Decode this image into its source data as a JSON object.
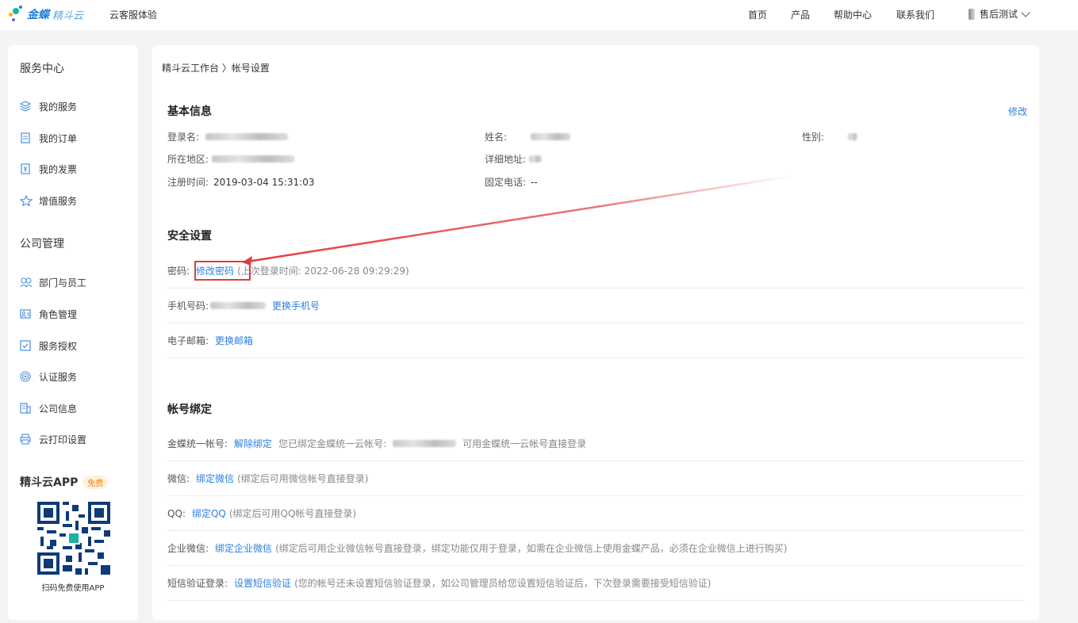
{
  "header": {
    "logo_text": "金蝶",
    "logo_sub": "精斗云",
    "app_name": "云客服体验",
    "nav": [
      "首页",
      "产品",
      "帮助中心",
      "联系我们"
    ],
    "user_name": "售后测试"
  },
  "sidebar": {
    "service_center": "服务中心",
    "service_items": [
      "我的服务",
      "我的订单",
      "我的发票",
      "增值服务"
    ],
    "company_section": "公司管理",
    "company_items": [
      "部门与员工",
      "角色管理",
      "服务授权",
      "认证服务",
      "公司信息",
      "云打印设置"
    ],
    "app_title": "精斗云APP",
    "app_badge": "免费",
    "qr_caption": "扫码免费使用APP"
  },
  "main": {
    "breadcrumb": "精斗云工作台 〉帐号设置",
    "basic": {
      "title": "基本信息",
      "edit": "修改",
      "login_label": "登录名:",
      "name_label": "姓名:",
      "gender_label": "性别:",
      "region_label": "所在地区:",
      "address_label": "详细地址:",
      "reg_label": "注册时间:",
      "reg_value": "2019-03-04 15:31:03",
      "phone_label": "固定电话:",
      "phone_value": "--"
    },
    "security": {
      "title": "安全设置",
      "password_label": "密码:",
      "password_link": "修改密码",
      "password_note": "(上次登录时间: 2022-06-28 09:29:29)",
      "mobile_label": "手机号码:",
      "mobile_link": "更换手机号",
      "email_label": "电子邮箱:",
      "email_link": "更换邮箱"
    },
    "binding": {
      "title": "帐号绑定",
      "kingdee_label": "金蝶统一帐号:",
      "kingdee_link": "解除绑定",
      "kingdee_note1": "您已绑定金蝶统一云帐号:",
      "kingdee_note2": "可用金蝶统一云帐号直接登录",
      "wechat_label": "微信:",
      "wechat_link": "绑定微信",
      "wechat_note": "(绑定后可用微信帐号直接登录)",
      "qq_label": "QQ:",
      "qq_link": "绑定QQ",
      "qq_note": "(绑定后可用QQ帐号直接登录)",
      "wework_label": "企业微信:",
      "wework_link": "绑定企业微信",
      "wework_note": "(绑定后可用企业微信帐号直接登录，绑定功能仅用于登录，如需在企业微信上使用金蝶产品，必须在企业微信上进行购买)",
      "sms_label": "短信验证登录:",
      "sms_link": "设置短信验证",
      "sms_note": "(您的帐号还未设置短信验证登录，如公司管理员给您设置短信验证后，下次登录需要接受短信验证)"
    }
  },
  "colors": {
    "accent": "#2e7fe3",
    "highlight": "#e23b3b",
    "background": "#f3f4f6"
  },
  "icons": [
    "logo-icon",
    "stack-icon",
    "order-icon",
    "invoice-icon",
    "star-icon",
    "people-icon",
    "role-icon",
    "check-icon",
    "cert-icon",
    "building-icon",
    "printer-icon",
    "qr-code",
    "chevron-down-icon"
  ]
}
